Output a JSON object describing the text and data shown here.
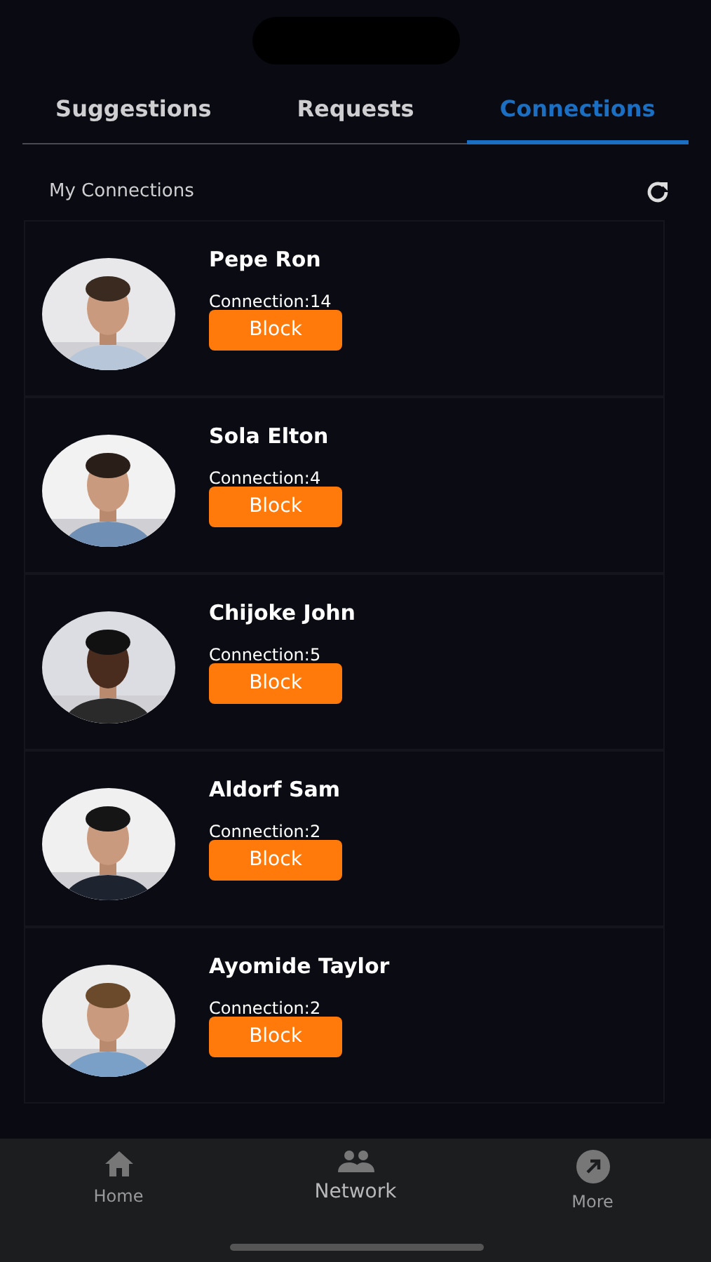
{
  "tabs": [
    {
      "label": "Suggestions",
      "selected": false
    },
    {
      "label": "Requests",
      "selected": false
    },
    {
      "label": "Connections",
      "selected": true
    }
  ],
  "section": {
    "title": "My Connections"
  },
  "connections": [
    {
      "name": "Pepe Ron",
      "count": "Connection:14",
      "action": "Block"
    },
    {
      "name": "Sola Elton",
      "count": "Connection:4",
      "action": "Block"
    },
    {
      "name": "Chijoke John",
      "count": "Connection:5",
      "action": "Block"
    },
    {
      "name": "Aldorf Sam",
      "count": "Connection:2",
      "action": "Block"
    },
    {
      "name": "Ayomide Taylor",
      "count": "Connection:2",
      "action": "Block"
    }
  ],
  "bottom_nav": [
    {
      "label": "Home",
      "selected": false
    },
    {
      "label": "Network",
      "selected": true
    },
    {
      "label": "More",
      "selected": false
    }
  ]
}
